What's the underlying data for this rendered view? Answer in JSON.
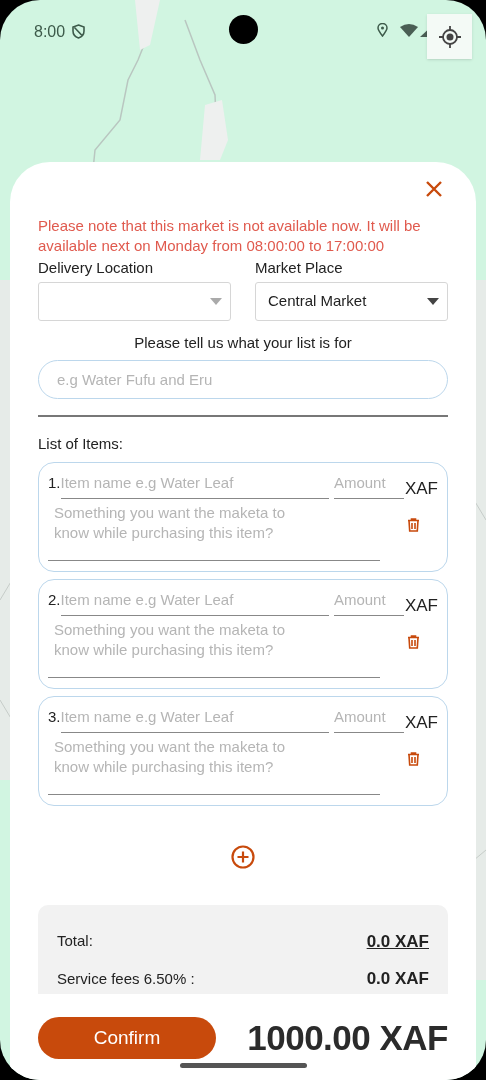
{
  "status_bar": {
    "time": "8:00"
  },
  "notice": "Please note that this market is not available now. It will be available next on Monday from 08:00:00 to 17:00:00",
  "delivery_location": {
    "label": "Delivery Location"
  },
  "market_place": {
    "label": "Market Place",
    "value": "Central Market"
  },
  "list_prompt": "Please tell us what your list is for",
  "list_purpose": {
    "placeholder": "e.g Water Fufu and Eru"
  },
  "items_heading": "List of Items:",
  "items": [
    {
      "number": "1.",
      "name_placeholder": "Item name e.g Water Leaf",
      "amount_placeholder": "Amount",
      "currency": "XAF",
      "note_placeholder": "Something you want the maketa to know while purchasing this item?"
    },
    {
      "number": "2.",
      "name_placeholder": "Item name e.g Water Leaf",
      "amount_placeholder": "Amount",
      "currency": "XAF",
      "note_placeholder": "Something you want the maketa to know while purchasing this item?"
    },
    {
      "number": "3.",
      "name_placeholder": "Item name e.g Water Leaf",
      "amount_placeholder": "Amount",
      "currency": "XAF",
      "note_placeholder": "Something you want the maketa to know while purchasing this item?"
    }
  ],
  "summary": [
    {
      "label": "Total:",
      "value": "0.0 XAF"
    },
    {
      "label": "Service fees 6.50% :",
      "value": "0.0 XAF"
    }
  ],
  "confirm": "Confirm",
  "grand_total": "1000.00 XAF"
}
